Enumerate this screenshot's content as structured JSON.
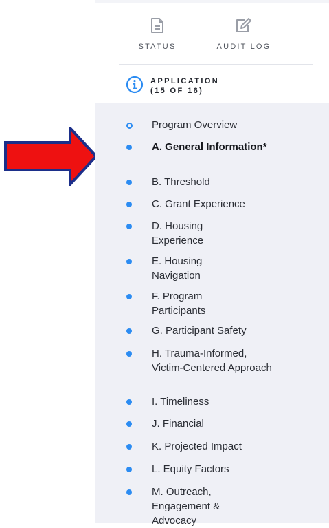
{
  "toolbar": {
    "status_label": "STATUS",
    "audit_log_label": "AUDIT LOG",
    "status_icon": "document-icon",
    "audit_icon": "edit-icon"
  },
  "application": {
    "title": "APPLICATION",
    "progress": "(15 OF 16)",
    "icon": "info-icon"
  },
  "nav": {
    "items": [
      {
        "label": "Program Overview"
      },
      {
        "label": "A. General Information*"
      },
      {
        "label": "B. Threshold"
      },
      {
        "label": "C. Grant Experience"
      },
      {
        "label": "D. Housing Experience"
      },
      {
        "label": "E. Housing Navigation"
      },
      {
        "label": "F. Program Participants"
      },
      {
        "label": "G. Participant Safety"
      },
      {
        "label": "H. Trauma-Informed, Victim-Centered Approach"
      },
      {
        "label": "I. Timeliness"
      },
      {
        "label": "J. Financial"
      },
      {
        "label": "K. Projected Impact"
      },
      {
        "label": "L. Equity Factors"
      },
      {
        "label": "M. Outreach, Engagement & Advocacy"
      }
    ]
  },
  "colors": {
    "accent": "#2c8cf2",
    "annotation_arrow_fill": "#ee1111",
    "annotation_arrow_stroke": "#1c2f8a",
    "nav_background": "#eff0f6"
  }
}
